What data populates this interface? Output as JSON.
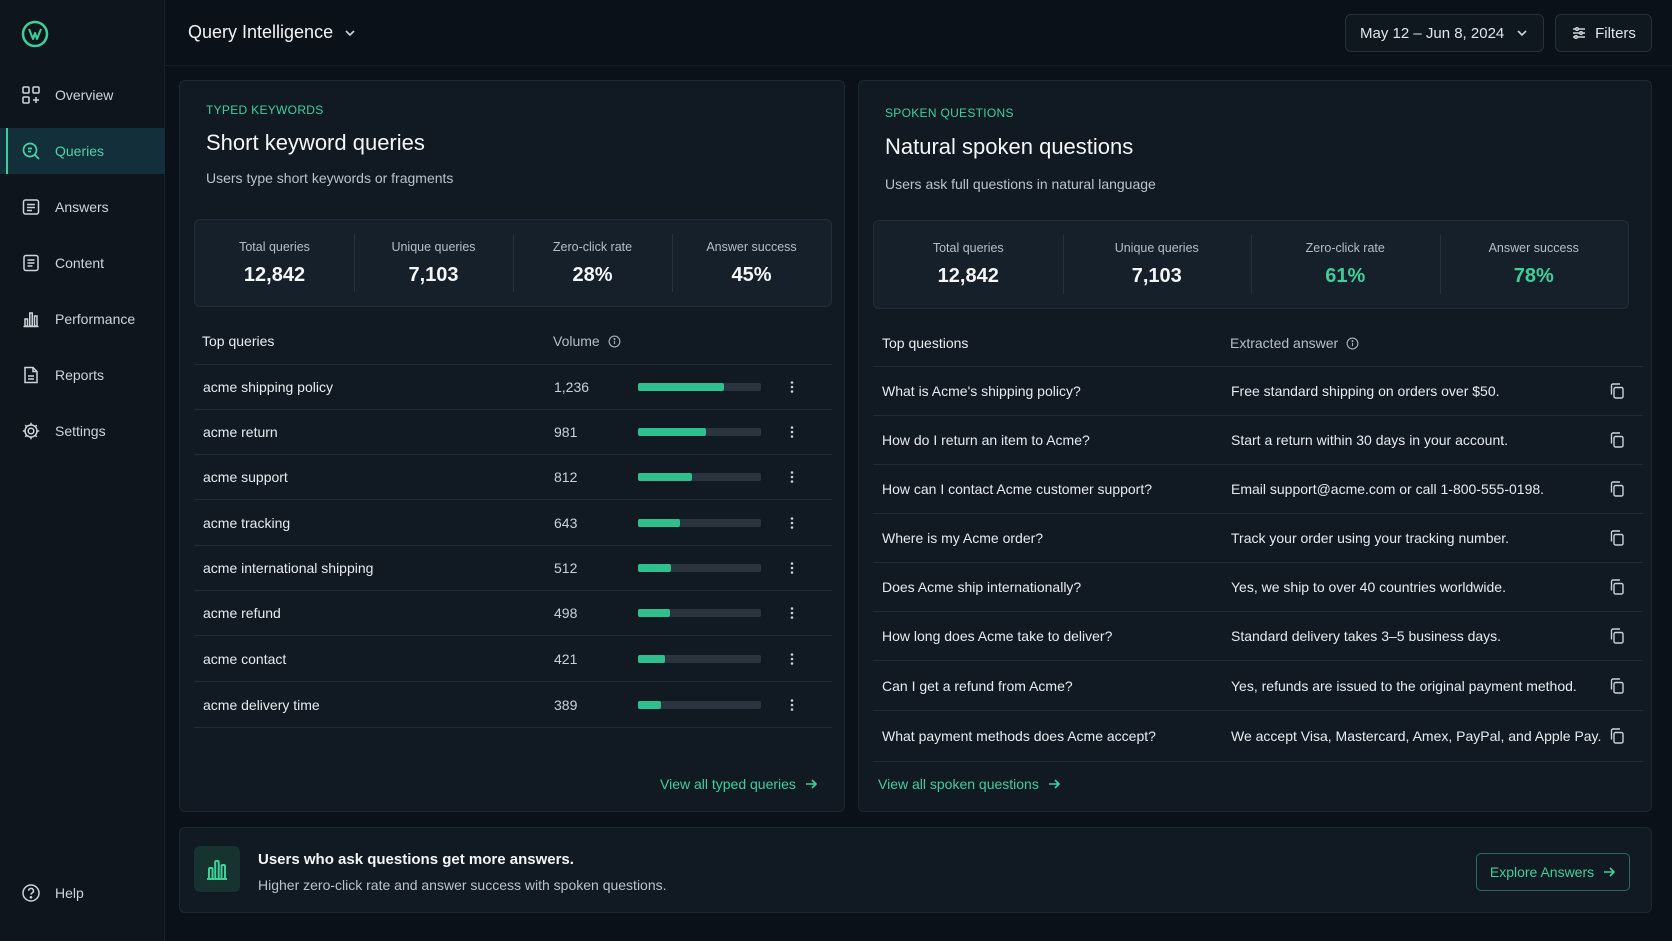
{
  "colors": {
    "accent": "#3ecf9a",
    "background": "#0b1118",
    "card": "#111a23"
  },
  "sidebar": {
    "items": [
      {
        "label": "Overview",
        "icon": "overview-icon"
      },
      {
        "label": "Queries",
        "icon": "queries-icon",
        "active": true
      },
      {
        "label": "Answers",
        "icon": "answers-icon"
      },
      {
        "label": "Content",
        "icon": "content-icon"
      },
      {
        "label": "Performance",
        "icon": "performance-icon"
      },
      {
        "label": "Reports",
        "icon": "reports-icon"
      },
      {
        "label": "Settings",
        "icon": "settings-icon"
      }
    ],
    "help_label": "Help"
  },
  "header": {
    "title": "Query Intelligence",
    "date_range": "May 12 – Jun 8, 2024",
    "filters_label": "Filters"
  },
  "typed": {
    "eyebrow": "TYPED KEYWORDS",
    "title": "Short keyword queries",
    "subtitle": "Users type short keywords or fragments",
    "stats": [
      {
        "label": "Total queries",
        "value": "12,842"
      },
      {
        "label": "Unique queries",
        "value": "7,103"
      },
      {
        "label": "Zero-click rate",
        "value": "28%"
      },
      {
        "label": "Answer success",
        "value": "45%"
      }
    ],
    "col_query": "Top queries",
    "col_volume": "Volume",
    "rows": [
      {
        "query": "acme shipping policy",
        "volume": "1,236",
        "share": 0.7
      },
      {
        "query": "acme return",
        "volume": "981",
        "share": 0.55
      },
      {
        "query": "acme support",
        "volume": "812",
        "share": 0.44
      },
      {
        "query": "acme tracking",
        "volume": "643",
        "share": 0.34
      },
      {
        "query": "acme international shipping",
        "volume": "512",
        "share": 0.27
      },
      {
        "query": "acme refund",
        "volume": "498",
        "share": 0.26
      },
      {
        "query": "acme contact",
        "volume": "421",
        "share": 0.22
      },
      {
        "query": "acme delivery time",
        "volume": "389",
        "share": 0.19
      }
    ],
    "view_all": "View all typed queries"
  },
  "spoken": {
    "eyebrow": "SPOKEN QUESTIONS",
    "title": "Natural spoken questions",
    "subtitle": "Users ask full questions in natural language",
    "stats": [
      {
        "label": "Total queries",
        "value": "12,842"
      },
      {
        "label": "Unique queries",
        "value": "7,103"
      },
      {
        "label": "Zero-click rate",
        "value": "61%"
      },
      {
        "label": "Answer success",
        "value": "78%"
      }
    ],
    "col_question": "Top questions",
    "col_answer": "Extracted answer",
    "rows": [
      {
        "question": "What is Acme's shipping policy?",
        "answer": "Free standard shipping on orders over $50."
      },
      {
        "question": "How do I return an item to Acme?",
        "answer": "Start a return within 30 days in your account."
      },
      {
        "question": "How can I contact Acme customer support?",
        "answer": "Email support@acme.com or call 1-800-555-0198."
      },
      {
        "question": "Where is my Acme order?",
        "answer": "Track your order using your tracking number."
      },
      {
        "question": "Does Acme ship internationally?",
        "answer": "Yes, we ship to over 40 countries worldwide."
      },
      {
        "question": "How long does Acme take to deliver?",
        "answer": "Standard delivery takes 3–5 business days."
      },
      {
        "question": "Can I get a refund from Acme?",
        "answer": "Yes, refunds are issued to the original payment method."
      },
      {
        "question": "What payment methods does Acme accept?",
        "answer": "We accept Visa, Mastercard, Amex, PayPal, and Apple Pay."
      }
    ],
    "view_all": "View all spoken questions"
  },
  "banner": {
    "title": "Users who ask questions get more answers.",
    "subtitle": "Higher zero-click rate and answer success with spoken questions.",
    "cta": "Explore Answers"
  }
}
